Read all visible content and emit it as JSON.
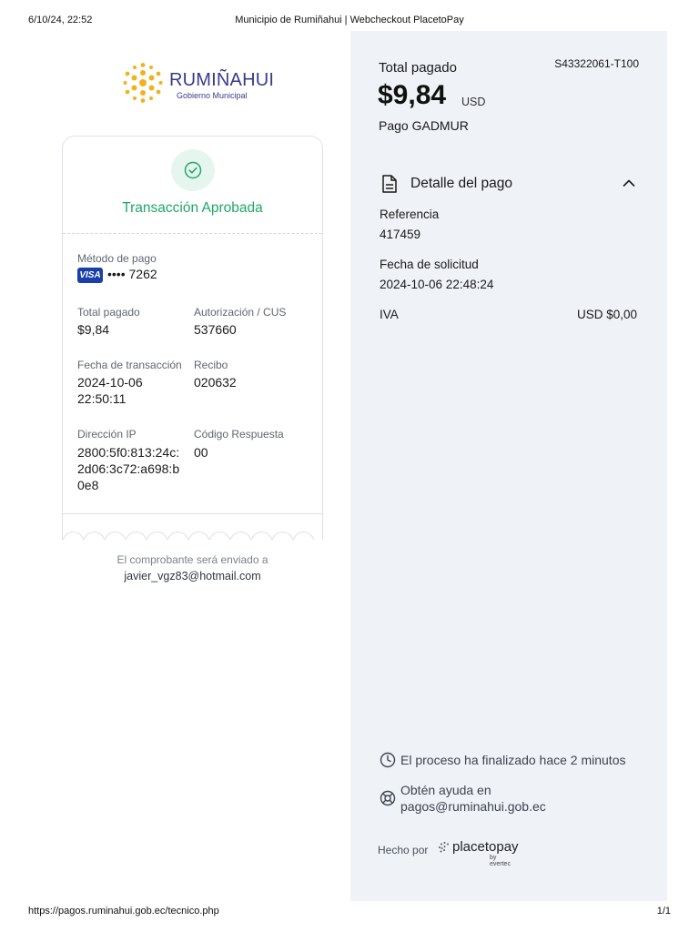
{
  "print": {
    "date": "6/10/24, 22:52",
    "title": "Municipio de Rumiñahui | Webcheckout PlacetoPay",
    "url": "https://pagos.ruminahui.gob.ec/tecnico.php",
    "page": "1/1"
  },
  "brand": {
    "name": "RUMIÑAHUI",
    "subtitle": "Gobierno Municipal",
    "icon": "flower-logo",
    "color": "#3a3a8c",
    "accent": "#f2b21f"
  },
  "receipt": {
    "status": "Transacción Aprobada",
    "status_color": "#1fa86a",
    "payment_method_label": "Método de pago",
    "card_brand": "VISA",
    "card_number": "•••• 7262",
    "total_label": "Total pagado",
    "total_value": "$9,84",
    "auth_label": "Autorización / CUS",
    "auth_value": "537660",
    "date_label": "Fecha de transacción",
    "date_value": "2024-10-06",
    "time_value": "22:50:11",
    "receipt_label": "Recibo",
    "receipt_value": "020632",
    "ip_label": "Dirección IP",
    "ip_lines": [
      "2800:5f0:813:24c:",
      "2d06:3c72:a698:b",
      "0e8"
    ],
    "response_label": "Código Respuesta",
    "response_value": "00",
    "email_note": "El comprobante será enviado a",
    "email": "javier_vgz83@hotmail.com"
  },
  "summary": {
    "total_label": "Total pagado",
    "reference_code": "S43322061-T100",
    "amount": "$9,84",
    "currency": "USD",
    "description": "Pago GADMUR",
    "detail_title": "Detalle del pago",
    "reference_label": "Referencia",
    "reference_value": "417459",
    "request_date_label": "Fecha de solicitud",
    "request_date_value": "2024-10-06 22:48:24",
    "iva_label": "IVA",
    "iva_value": "USD $0,00",
    "process_status": "El proceso ha finalizado hace 2 minutos",
    "help_line1": "Obtén ayuda en",
    "help_line2": "pagos@ruminahui.gob.ec",
    "made_by": "Hecho por",
    "provider": "placetopay",
    "provider_by": "by evertec"
  }
}
